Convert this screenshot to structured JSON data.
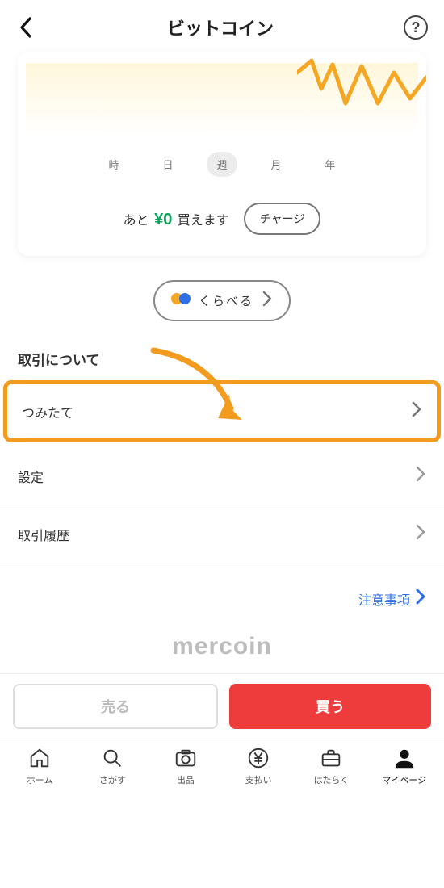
{
  "header": {
    "title": "ビットコイン"
  },
  "card": {
    "periods": [
      "時",
      "日",
      "週",
      "月",
      "年"
    ],
    "active_period_index": 2,
    "balance_prefix": "あと",
    "balance_amount": "¥0",
    "balance_suffix": "買えます",
    "charge_label": "チャージ"
  },
  "compare": {
    "label": "くらべる"
  },
  "section_heading": "取引について",
  "rows": [
    {
      "label": "つみたて",
      "highlight": true
    },
    {
      "label": "設定",
      "highlight": false
    },
    {
      "label": "取引履歴",
      "highlight": false
    }
  ],
  "notes_label": "注意事項",
  "brand": "mercoin",
  "trade": {
    "sell": "売る",
    "buy": "買う"
  },
  "nav": [
    {
      "label": "ホーム"
    },
    {
      "label": "さがす"
    },
    {
      "label": "出品"
    },
    {
      "label": "支払い"
    },
    {
      "label": "はたらく"
    },
    {
      "label": "マイページ"
    }
  ],
  "nav_active_index": 5
}
